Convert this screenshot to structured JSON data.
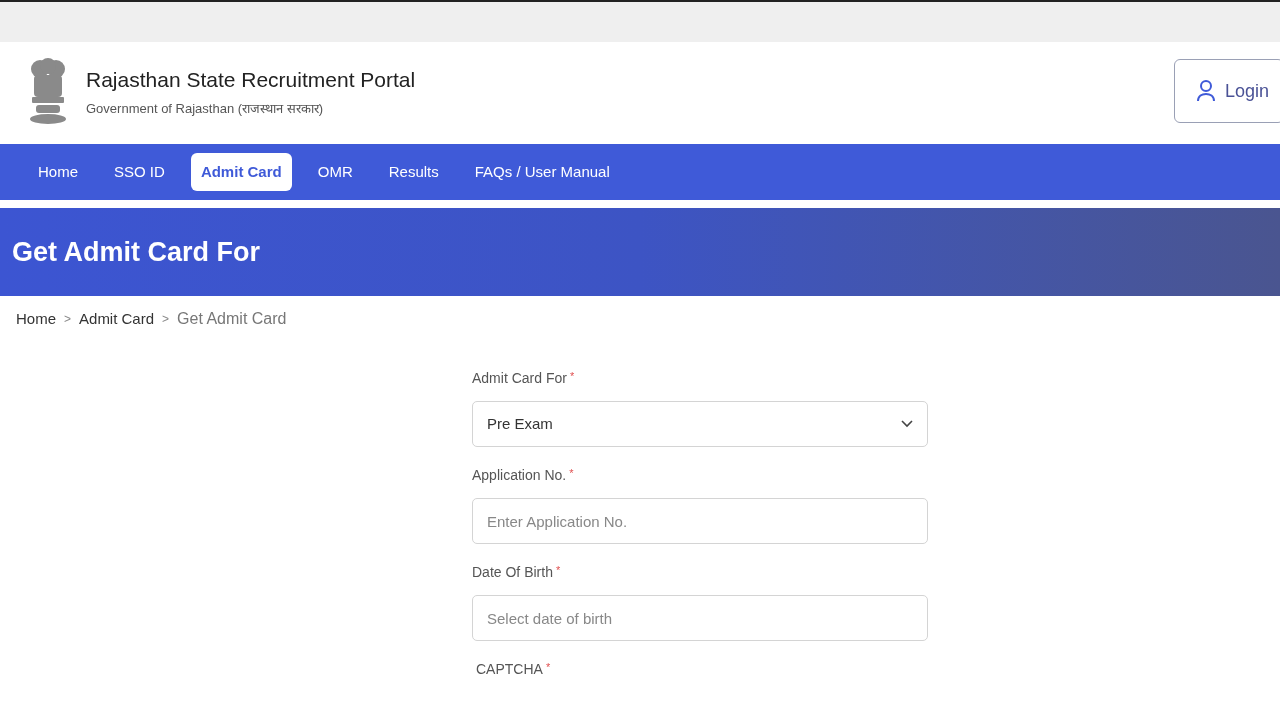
{
  "header": {
    "title": "Rajasthan State Recruitment Portal",
    "subtitle": "Government of Rajasthan (राजस्थान सरकार)",
    "login": "Login"
  },
  "nav": [
    {
      "label": "Home",
      "selected": false
    },
    {
      "label": "SSO ID",
      "selected": false
    },
    {
      "label": "Admit Card",
      "selected": true
    },
    {
      "label": "OMR",
      "selected": false
    },
    {
      "label": "Results",
      "selected": false
    },
    {
      "label": "FAQs / User Manual",
      "selected": false
    }
  ],
  "banner": {
    "title": "Get Admit Card For"
  },
  "breadcrumb": [
    {
      "label": "Home",
      "current": false
    },
    {
      "label": "Admit Card",
      "current": false
    },
    {
      "label": "Get Admit Card",
      "current": true
    }
  ],
  "breadcrumb_separator": ">",
  "form": [
    {
      "kind": "select",
      "label": "Admit Card For",
      "mark": "*",
      "value": "Pre Exam"
    },
    {
      "kind": "input",
      "label": "Application No.",
      "mark": "*",
      "placeholder": "Enter Application No."
    },
    {
      "kind": "input",
      "label": "Date Of Birth",
      "mark": "*",
      "placeholder": "Select date of birth"
    },
    {
      "kind": "label",
      "label": "CAPTCHA",
      "mark": "*"
    }
  ]
}
